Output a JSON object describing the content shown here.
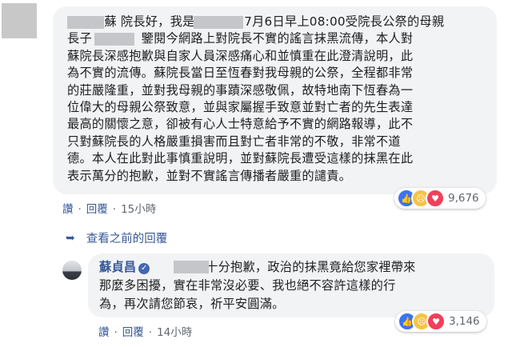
{
  "comment1": {
    "text": "　　　蘇 院長好，我是　　　，7月6日早上08:00受院長公祭的母親\n長子　　　。鑒閱今網路上對院長不實的謠言抹黑流傳，本人對\n蘇院長深感抱歉與自家人員深感痛心和並慎重在此澄清說明，此\n為不實的流傳。蘇院長當日至恆春對我母親的公祭，全程都非常\n的莊嚴隆重，並對我母親的事蹟深感敬佩，故特地南下恆春為一\n位偉大的母親公祭致意，並與家屬握手致意並對亡者的先生表達\n最高的關懷之意，卻被有心人士特意給予不實的網路報導，此不\n只對蘇院長的人格嚴重損害而且對亡者非常的不敬，非常不道\n德。本人在此對此事慎重說明，並對蘇院長遭受這樣的抹黑在此\n表示萬分的抱歉，並對不實謠言傳播者嚴重的譴責。",
    "like_label": "讚",
    "reply_label": "回覆",
    "time": "15小時",
    "reaction_count": "9,676",
    "reaction_icons": [
      "like-icon",
      "sad-icon",
      "love-icon"
    ]
  },
  "view_previous": {
    "label": "查看之前的回覆"
  },
  "reply": {
    "author": "蘇貞昌",
    "text": "　　　，十分抱歉，政治的抹黑竟給您家裡帶來\n那麼多困擾，實在非常沒必要、我也絕不容許這樣的行\n為，再次請您節哀，祈平安圓滿。",
    "like_label": "讚",
    "reply_label": "回覆",
    "time": "14小時",
    "reaction_count": "3,146"
  },
  "colors": {
    "link": "#385898",
    "bubble": "#f2f3f5",
    "redaction": "#c4c6ca"
  }
}
